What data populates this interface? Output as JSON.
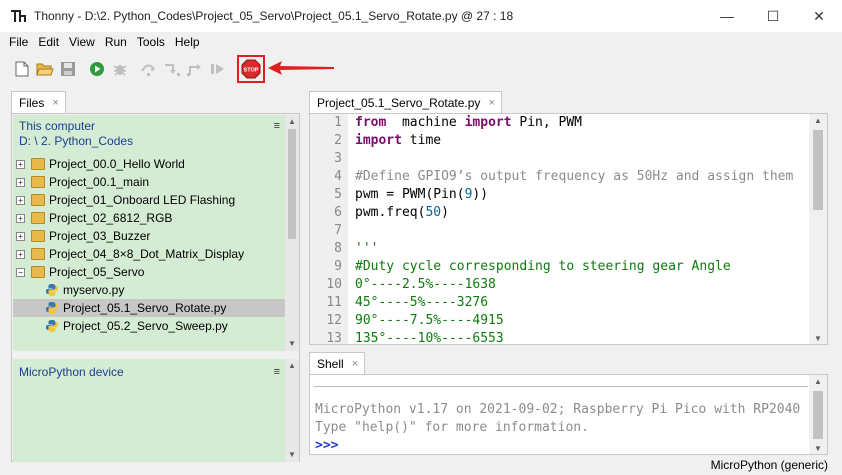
{
  "window": {
    "title": "Thonny  -  D:\\2. Python_Codes\\Project_05_Servo\\Project_05.1_Servo_Rotate.py  @  27 : 18",
    "app_icon_glyph": "Th",
    "minimize": "—",
    "maximize": "☐",
    "close": "✕"
  },
  "menu": [
    "File",
    "Edit",
    "View",
    "Run",
    "Tools",
    "Help"
  ],
  "toolbar": {
    "buttons": [
      "new-file-icon",
      "open-folder-icon",
      "save-icon",
      "run-icon",
      "debug-icon",
      "step-over-icon",
      "step-into-icon",
      "step-out-icon",
      "resume-icon"
    ],
    "stop_label": "STOP"
  },
  "files_panel": {
    "tab_label": "Files",
    "tab_close": "×",
    "this_computer": "This computer",
    "path": "D: \\ 2. Python_Codes",
    "menu_glyph": "≡",
    "tree": [
      {
        "type": "folder",
        "expander": "+",
        "label": "Project_00.0_Hello World"
      },
      {
        "type": "folder",
        "expander": "+",
        "label": "Project_00.1_main"
      },
      {
        "type": "folder",
        "expander": "+",
        "label": "Project_01_Onboard LED Flashing"
      },
      {
        "type": "folder",
        "expander": "+",
        "label": "Project_02_6812_RGB"
      },
      {
        "type": "folder",
        "expander": "+",
        "label": "Project_03_Buzzer"
      },
      {
        "type": "folder",
        "expander": "+",
        "label": "Project_04_8×8_Dot_Matrix_Display"
      },
      {
        "type": "folder",
        "expander": "−",
        "label": "Project_05_Servo"
      },
      {
        "type": "file",
        "label": "myservo.py"
      },
      {
        "type": "file",
        "label": "Project_05.1_Servo_Rotate.py",
        "selected": true
      },
      {
        "type": "file",
        "label": "Project_05.2_Servo_Sweep.py"
      }
    ],
    "device_label": "MicroPython device"
  },
  "editor": {
    "tab_label": "Project_05.1_Servo_Rotate.py",
    "tab_close": "×",
    "line_numbers": [
      "1",
      "2",
      "3",
      "4",
      "5",
      "6",
      "7",
      "8",
      "9",
      "10",
      "11",
      "12",
      "13"
    ],
    "code_lines": [
      [
        [
          "kw",
          "from"
        ],
        [
          "",
          "  machine "
        ],
        [
          "kw",
          "import"
        ],
        [
          "",
          " Pin, PWM"
        ]
      ],
      [
        [
          "kw",
          "import"
        ],
        [
          "",
          " time"
        ]
      ],
      [],
      [
        [
          "cm",
          "#Define GPIO9’s output frequency as 50Hz and assign them"
        ]
      ],
      [
        [
          "",
          "pwm = PWM(Pin("
        ],
        [
          "num",
          "9"
        ],
        [
          "",
          "))"
        ]
      ],
      [
        [
          "",
          "pwm.freq("
        ],
        [
          "num",
          "50"
        ],
        [
          "",
          ")"
        ]
      ],
      [],
      [
        [
          "grn",
          "'''"
        ]
      ],
      [
        [
          "grn",
          "#Duty cycle corresponding to steering gear Angle"
        ]
      ],
      [
        [
          "grn",
          "0°----2.5%----1638"
        ]
      ],
      [
        [
          "grn",
          "45°----5%----3276"
        ]
      ],
      [
        [
          "grn",
          "90°----7.5%----4915"
        ]
      ],
      [
        [
          "grn",
          "135°----10%----6553"
        ]
      ]
    ]
  },
  "shell": {
    "tab_label": "Shell",
    "tab_close": "×",
    "lines": [
      "MicroPython v1.17 on 2021-09-02; Raspberry Pi Pico with RP2040",
      "Type \"help()\" for more information."
    ],
    "prompt": ">>>"
  },
  "status": {
    "interpreter": "MicroPython (generic)"
  },
  "colors": {
    "files_bg": "#d5ecd4",
    "stop_highlight": "#e02020",
    "keyword": "#7a0e6b",
    "comment": "#8c8c8c",
    "string": "#0f7a0f"
  }
}
